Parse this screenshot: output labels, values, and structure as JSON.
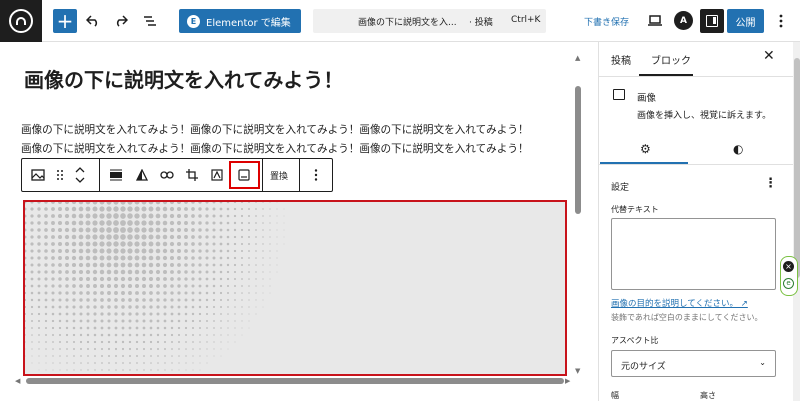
{
  "topbar": {
    "elementor_label": "Elementor で編集",
    "elementor_icon": "E",
    "command_title": "画像の下に説明文を入...",
    "command_type": "· 投稿",
    "command_shortcut": "Ctrl+K",
    "draft_label": "下書き保存",
    "publish_label": "公開",
    "astra_icon": "A"
  },
  "editor": {
    "title": "画像の下に説明文を入れてみよう！",
    "paragraph_lines": [
      "画像の下に説明文を入れてみよう！画像の下に説明文を入れてみよう！画像の下に説明文を入れてみよう！",
      "画像の下に説明文を入れてみよう！画像の下に説明文を入れてみよう！画像の下に説明文を入れてみよう！"
    ],
    "block_toolbar": {
      "replace_label": "置換"
    }
  },
  "sidebar": {
    "tabs": [
      {
        "label": "投稿"
      },
      {
        "label": "ブロック"
      }
    ],
    "block_name": "画像",
    "block_description": "画像を挿入し、視覚に訴えます。",
    "settings_label": "設定",
    "alt_label": "代替テキスト",
    "alt_value": "",
    "alt_link": "画像の目的を説明してください。",
    "alt_help": "装飾であれば空白のままにしてください。",
    "aspect_label": "アスペクト比",
    "aspect_value": "元のサイズ",
    "width_label": "幅",
    "height_label": "高さ"
  },
  "colors": {
    "accent": "#2271b1",
    "highlight": "#c8131b",
    "dark": "#1e1e1e"
  }
}
